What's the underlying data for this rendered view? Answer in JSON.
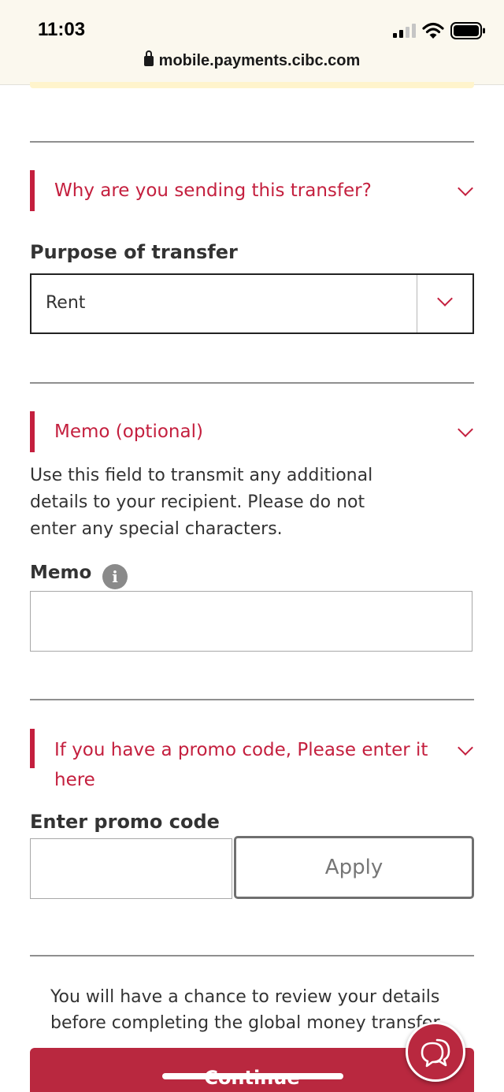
{
  "status_bar": {
    "time": "11:03"
  },
  "browser": {
    "url": "mobile.payments.cibc.com"
  },
  "purpose_section": {
    "title": "Why are you sending this transfer?",
    "field_label": "Purpose of transfer",
    "selected_value": "Rent"
  },
  "memo_section": {
    "title": "Memo (optional)",
    "help_text": "Use this field to transmit any additional details to your recipient. Please do not enter any special characters.",
    "field_label": "Memo",
    "info_icon_glyph": "i",
    "value": ""
  },
  "promo_section": {
    "title_line1": "If you have a promo code, Please enter it",
    "title_line2": "here",
    "field_label": "Enter promo code",
    "value": "",
    "apply_label": "Apply"
  },
  "footer": {
    "review_text": "You will have a chance to review your details before completing the global money transfer.",
    "continue_label": "Continue"
  },
  "colors": {
    "brand_red": "#c41f3e",
    "button_red": "#b9283f"
  },
  "icons": [
    "lock-icon",
    "signal-icon",
    "wifi-icon",
    "battery-icon",
    "chevron-down-icon",
    "info-icon",
    "chat-icon"
  ]
}
